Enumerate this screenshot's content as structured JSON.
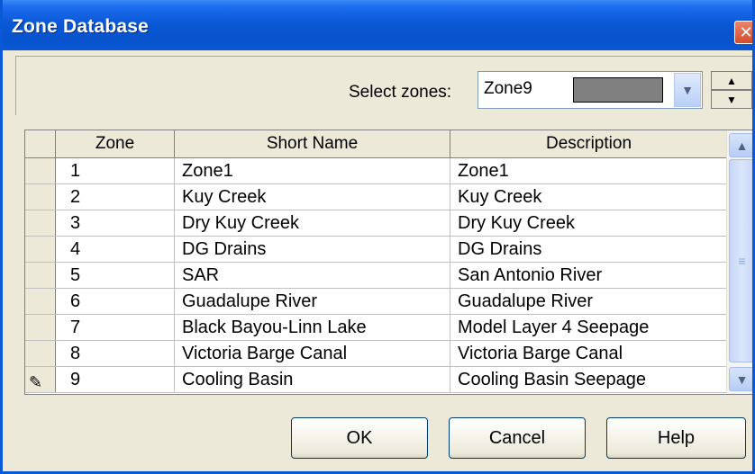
{
  "window": {
    "title": "Zone Database",
    "close_glyph": "✕"
  },
  "select": {
    "label": "Select zones:",
    "value": "Zone9",
    "swatch_color": "#808080"
  },
  "columns": {
    "zone": "Zone",
    "short_name": "Short Name",
    "description": "Description"
  },
  "rows": [
    {
      "zone": "1",
      "color": "#ffffff",
      "short_name": "Zone1",
      "description": "Zone1"
    },
    {
      "zone": "2",
      "color": "#000080",
      "short_name": "Kuy Creek",
      "description": "Kuy Creek"
    },
    {
      "zone": "3",
      "color": "#008000",
      "short_name": "Dry Kuy Creek",
      "description": "Dry Kuy Creek"
    },
    {
      "zone": "4",
      "color": "#008080",
      "short_name": "DG Drains",
      "description": "DG Drains"
    },
    {
      "zone": "5",
      "color": "#800000",
      "short_name": "SAR",
      "description": "San Antonio River"
    },
    {
      "zone": "6",
      "color": "#800080",
      "short_name": "Guadalupe River",
      "description": "Guadalupe River"
    },
    {
      "zone": "7",
      "color": "#808000",
      "short_name": "Black Bayou-Linn Lake",
      "description": "Model Layer 4 Seepage"
    },
    {
      "zone": "8",
      "color": "#c0c0c0",
      "short_name": "Victoria Barge Canal",
      "description": "Victoria Barge Canal"
    },
    {
      "zone": "9",
      "color": "#808080",
      "short_name": "Cooling Basin",
      "description": "Cooling Basin Seepage"
    }
  ],
  "buttons": {
    "ok": "OK",
    "cancel": "Cancel",
    "help": "Help"
  },
  "icons": {
    "edit_row": "pencil-icon",
    "close": "close-icon",
    "dropdown": "chevron-down-icon",
    "spin_up": "triangle-up-icon",
    "spin_down": "triangle-down-icon"
  }
}
